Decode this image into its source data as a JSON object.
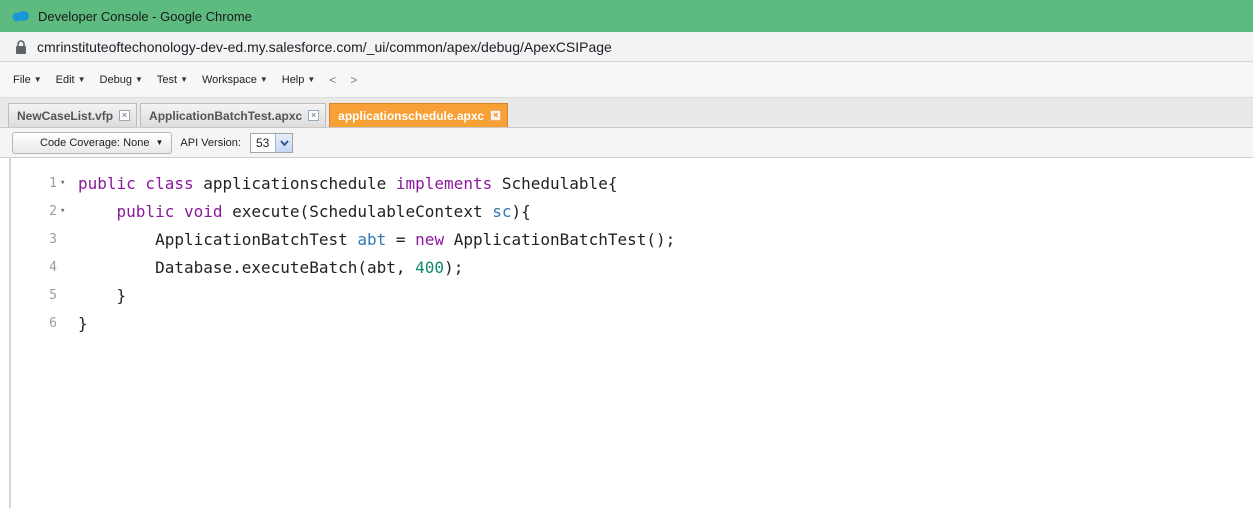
{
  "window": {
    "title": "Developer Console - Google Chrome",
    "url": "cmrinstituteoftechonology-dev-ed.my.salesforce.com/_ui/common/apex/debug/ApexCSIPage"
  },
  "menu": {
    "items": [
      "File",
      "Edit",
      "Debug",
      "Test",
      "Workspace",
      "Help"
    ],
    "back": "<",
    "forward": ">"
  },
  "tabs": [
    {
      "label": "NewCaseList.vfp",
      "active": false
    },
    {
      "label": "ApplicationBatchTest.apxc",
      "active": false
    },
    {
      "label": "applicationschedule.apxc",
      "active": true
    }
  ],
  "toolbar": {
    "coverage_label": "Code Coverage: None",
    "api_label": "API Version:",
    "api_value": "53"
  },
  "editor": {
    "lines": [
      {
        "num": "1",
        "fold": true,
        "tokens": [
          [
            "kw",
            "public class "
          ],
          [
            "plain",
            "applicationschedule "
          ],
          [
            "kw",
            "implements "
          ],
          [
            "plain",
            "Schedulable{"
          ]
        ]
      },
      {
        "num": "2",
        "fold": true,
        "tokens": [
          [
            "plain",
            "    "
          ],
          [
            "kw",
            "public void "
          ],
          [
            "plain",
            "execute(SchedulableContext "
          ],
          [
            "var",
            "sc"
          ],
          [
            "plain",
            "){"
          ]
        ]
      },
      {
        "num": "3",
        "fold": false,
        "tokens": [
          [
            "plain",
            "        ApplicationBatchTest "
          ],
          [
            "var",
            "abt"
          ],
          [
            "plain",
            " = "
          ],
          [
            "kw",
            "new "
          ],
          [
            "plain",
            "ApplicationBatchTest();"
          ]
        ]
      },
      {
        "num": "4",
        "fold": false,
        "tokens": [
          [
            "plain",
            "        Database.executeBatch(abt, "
          ],
          [
            "num",
            "400"
          ],
          [
            "plain",
            ");"
          ]
        ]
      },
      {
        "num": "5",
        "fold": false,
        "tokens": [
          [
            "plain",
            "    }"
          ]
        ]
      },
      {
        "num": "6",
        "fold": false,
        "tokens": [
          [
            "plain",
            "}"
          ]
        ]
      }
    ]
  },
  "colors": {
    "titlebar": "#5dbb80",
    "active_tab": "#f7a035",
    "keyword": "#8b1a9c",
    "variable": "#2f78b7",
    "number": "#0f8a6a"
  }
}
